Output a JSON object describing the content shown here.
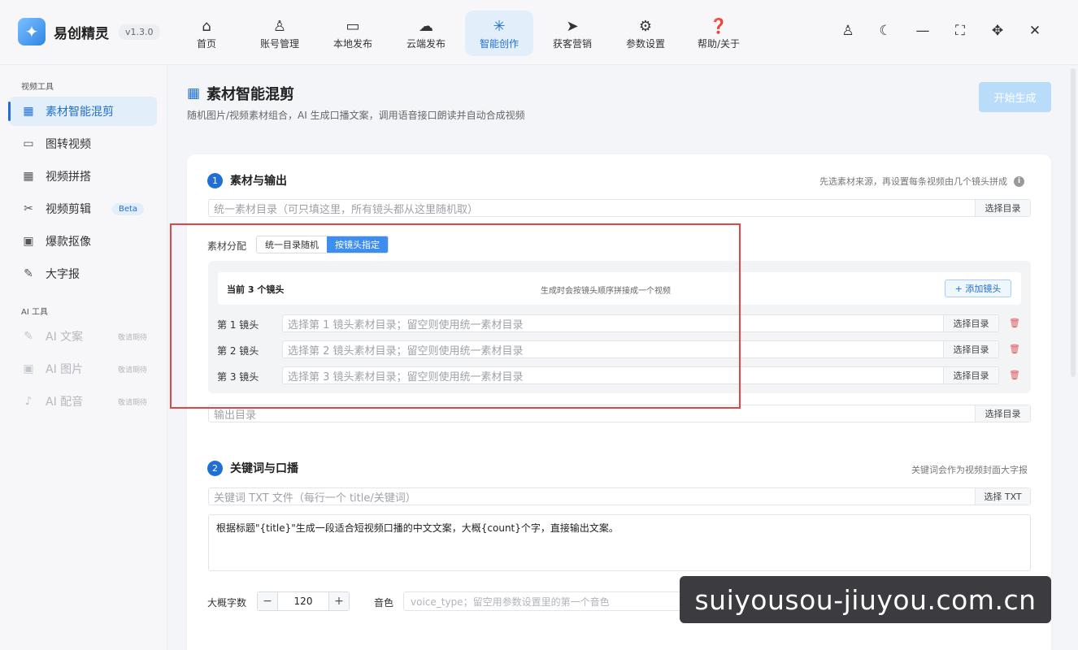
{
  "app": {
    "name": "易创精灵",
    "version": "v1.3.0",
    "logo_icon": "unicorn-logo-icon"
  },
  "nav": [
    {
      "label": "首页",
      "icon": "home-icon",
      "glyph": "⌂",
      "active": false
    },
    {
      "label": "账号管理",
      "icon": "user-icon",
      "glyph": "♙",
      "active": false
    },
    {
      "label": "本地发布",
      "icon": "monitor-icon",
      "glyph": "▭",
      "active": false
    },
    {
      "label": "云端发布",
      "icon": "cloud-icon",
      "glyph": "☁",
      "active": false
    },
    {
      "label": "智能创作",
      "icon": "sparkle-icon",
      "glyph": "✳",
      "active": true
    },
    {
      "label": "获客营销",
      "icon": "send-icon",
      "glyph": "➤",
      "active": false
    },
    {
      "label": "参数设置",
      "icon": "gear-icon",
      "glyph": "⚙",
      "active": false
    },
    {
      "label": "帮助/关于",
      "icon": "help-icon",
      "glyph": "❓",
      "active": false
    }
  ],
  "window_buttons": [
    {
      "name": "profile",
      "glyph": "♙"
    },
    {
      "name": "theme",
      "glyph": "☾"
    },
    {
      "name": "minimize",
      "glyph": "—"
    },
    {
      "name": "fullscreen",
      "glyph": "⛶"
    },
    {
      "name": "move",
      "glyph": "✥"
    },
    {
      "name": "close",
      "glyph": "✕"
    }
  ],
  "sidebar": {
    "video_section": "视频工具",
    "video_items": [
      {
        "label": "素材智能混剪",
        "glyph": "▦",
        "icon": "grid-icon",
        "active": true
      },
      {
        "label": "图转视频",
        "glyph": "▭",
        "icon": "video-icon"
      },
      {
        "label": "视频拼搭",
        "glyph": "▦",
        "icon": "grid-icon"
      },
      {
        "label": "视频剪辑",
        "glyph": "✂",
        "icon": "film-icon",
        "badge": "Beta"
      },
      {
        "label": "爆款抠像",
        "glyph": "▣",
        "icon": "image-icon"
      },
      {
        "label": "大字报",
        "glyph": "✎",
        "icon": "pen-icon"
      }
    ],
    "ai_section": "AI 工具",
    "ai_items": [
      {
        "label": "AI 文案",
        "glyph": "✎",
        "icon": "pen-icon",
        "soon": "敬请期待"
      },
      {
        "label": "AI 图片",
        "glyph": "▣",
        "icon": "image-icon",
        "soon": "敬请期待"
      },
      {
        "label": "AI 配音",
        "glyph": "♪",
        "icon": "mic-icon",
        "soon": "敬请期待"
      }
    ]
  },
  "page": {
    "title": "素材智能混剪",
    "subtitle": "随机图片/视频素材组合，AI 生成口播文案，调用语音接口朗读并自动合成视频",
    "start_button": "开始生成"
  },
  "section1": {
    "num": "1",
    "title": "素材与输出",
    "hint": "先选素材来源，再设置每条视频由几个镜头拼成",
    "material_dir_placeholder": "统一素材目录（可只填这里，所有镜头都从这里随机取）",
    "select_dir": "选择目录",
    "alloc_label": "素材分配",
    "alloc_options": [
      "统一目录随机",
      "按镜头指定"
    ],
    "shot_count": "当前 3 个镜头",
    "shot_tip": "生成时会按镜头顺序拼接成一个视频",
    "add_shot": "+ 添加镜头",
    "shots": [
      {
        "label": "第 1 镜头",
        "placeholder": "选择第 1 镜头素材目录；留空则使用统一素材目录"
      },
      {
        "label": "第 2 镜头",
        "placeholder": "选择第 2 镜头素材目录；留空则使用统一素材目录"
      },
      {
        "label": "第 3 镜头",
        "placeholder": "选择第 3 镜头素材目录；留空则使用统一素材目录"
      }
    ],
    "output_placeholder": "输出目录"
  },
  "section2": {
    "num": "2",
    "title": "关键词与口播",
    "hint": "关键词会作为视频封面大字报",
    "keyword_placeholder": "关键词 TXT 文件（每行一个 title/关键词）",
    "select_txt": "选择 TXT",
    "prompt": "根据标题\"{title}\"生成一段适合短视频口播的中文文案，大概{count}个字，直接输出文案。",
    "count_label": "大概字数",
    "count_value": "120",
    "minus": "−",
    "plus": "+",
    "voice_label": "音色",
    "voice_placeholder": "voice_type；留空用参数设置里的第一个音色"
  },
  "watermark": "suiyousou-jiuyou.com.cn",
  "colors": {
    "accent": "#1f6fd6",
    "highlight_box": "#e34545",
    "danger": "#e05555"
  }
}
